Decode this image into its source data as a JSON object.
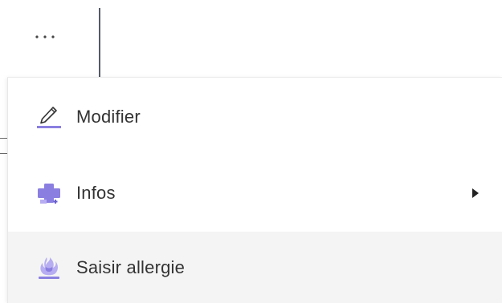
{
  "toolbar": {
    "more_icon": "ellipsis-icon"
  },
  "menu": {
    "items": [
      {
        "label": "Modifier",
        "icon": "pencil-icon",
        "has_submenu": false,
        "highlighted": false
      },
      {
        "label": "Infos",
        "icon": "medical-cross-icon",
        "has_submenu": true,
        "highlighted": false
      },
      {
        "label": "Saisir allergie",
        "icon": "allergy-icon",
        "has_submenu": false,
        "highlighted": true
      }
    ]
  },
  "colors": {
    "icon_accent": "#8a7fe0",
    "icon_accent_light": "#b7adf2",
    "text": "#333333",
    "hover_background": "#f4f4f4",
    "divider": "#555a66"
  }
}
